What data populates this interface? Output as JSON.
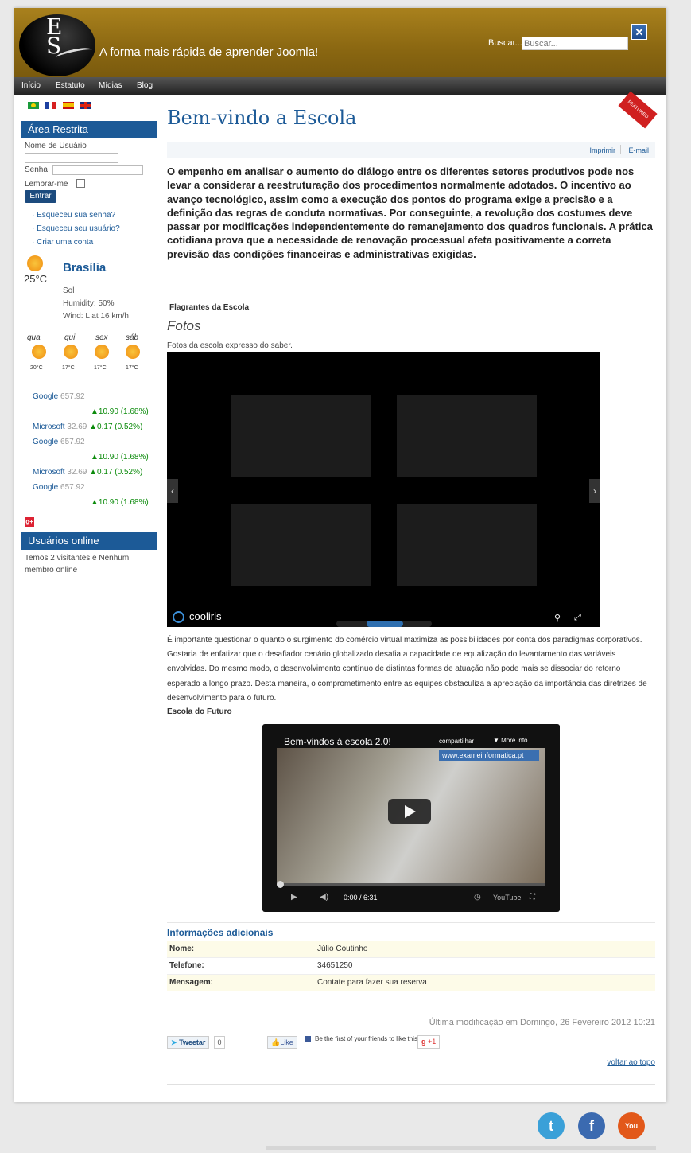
{
  "header": {
    "logo_letters": "E\nS",
    "tagline": "A forma mais rápida de aprender Joomla!",
    "search_label": "Buscar...",
    "search_placeholder": "Buscar...",
    "close_icon": "close-icon"
  },
  "nav": {
    "items": [
      "Início",
      "Estatuto",
      "Mídias",
      "Blog"
    ]
  },
  "flags": [
    "brazil-flag",
    "france-flag",
    "spain-flag",
    "uk-flag"
  ],
  "login": {
    "title": "Área Restrita",
    "username_label": "Nome de Usuário",
    "password_label": "Senha",
    "remember_label": "Lembrar-me",
    "submit_label": "Entrar",
    "links": [
      "Esqueceu sua senha?",
      "Esqueceu seu usuário?",
      "Criar uma conta"
    ]
  },
  "weather": {
    "temp": "25°C",
    "city": "Brasília",
    "condition": "Sol",
    "humidity": "Humidity: 50%",
    "wind": "Wind: L at 16 km/h",
    "forecast": [
      {
        "day": "qua",
        "low": "20°C"
      },
      {
        "day": "qui",
        "low": "17°C"
      },
      {
        "day": "sex",
        "low": "17°C"
      },
      {
        "day": "sáb",
        "low": "17°C"
      }
    ]
  },
  "stocks": [
    {
      "name": "Google",
      "price": "657.92",
      "change": "▲10.90 (1.68%)"
    },
    {
      "name": "Microsoft",
      "price": "32.69",
      "change": "▲0.17 (0.52%)"
    },
    {
      "name": "Google",
      "price": "657.92",
      "change": "▲10.90 (1.68%)"
    },
    {
      "name": "Microsoft",
      "price": "32.69",
      "change": "▲0.17 (0.52%)"
    },
    {
      "name": "Google",
      "price": "657.92",
      "change": "▲10.90 (1.68%)"
    }
  ],
  "online": {
    "title": "Usuários online",
    "text": "Temos 2 visitantes e Nenhum membro online"
  },
  "article": {
    "title": "Bem-vindo a Escola",
    "featured": "FEATURED",
    "print_label": "Imprimir",
    "email_label": "E-mail",
    "intro": "O empenho em analisar o aumento do diálogo entre os diferentes setores produtivos pode nos levar a considerar a reestruturação dos procedimentos normalmente adotados. O incentivo ao avanço tecnológico, assim como a execução dos pontos do programa exige a precisão e a definição das regras de conduta normativas. Por conseguinte, a revolução dos costumes deve passar por modificações independentemente do remanejamento dos quadros funcionais. A prática cotidiana prova que a necessidade de renovação processual afeta positivamente a correta previsão das condições financeiras e administrativas exigidas.",
    "section1": "Flagrantes da Escola",
    "gallery_title": "Fotos",
    "gallery_caption": "Fotos da escola expresso do saber.",
    "gallery_brand": "cooliris",
    "paragraph": "É importante questionar o quanto o surgimento do comércio virtual maximiza as possibilidades por conta dos paradigmas corporativos. Gostaria de enfatizar que o desafiador cenário globalizado desafia a capacidade de equalização do levantamento das variáveis envolvidas. Do mesmo modo, o desenvolvimento contínuo de distintas formas de atuação não pode mais se dissociar do retorno esperado a longo prazo. Desta maneira, o comprometimento entre as equipes obstaculiza a apreciação da importância das diretrizes de desenvolvimento para o futuro.",
    "section2": "Escola do Futuro"
  },
  "video": {
    "title": "Bem-vindos à escola 2.0!",
    "share": "compartilhar",
    "more": "More info",
    "url": "www.exameinformatica.pt",
    "time": "0:00 / 6:31",
    "brand": "YouTube"
  },
  "info": {
    "title": "Informações adicionais",
    "rows": [
      {
        "k": "Nome:",
        "v": "Júlio Coutinho"
      },
      {
        "k": "Telefone:",
        "v": "34651250"
      },
      {
        "k": "Mensagem:",
        "v": "Contate para fazer sua reserva"
      }
    ]
  },
  "modified": "Última modificação em Domingo, 26 Fevereiro 2012 10:21",
  "social_share": {
    "tweet": "Tweetar",
    "tweet_count": "0",
    "like": "Like",
    "fb_text": "Be the first of your friends to like this.",
    "gplus": "+1"
  },
  "back_to_top": "voltar ao topo",
  "colors": {
    "accent": "#1c5a97",
    "header": "#8a6711",
    "nav": "#333333"
  }
}
